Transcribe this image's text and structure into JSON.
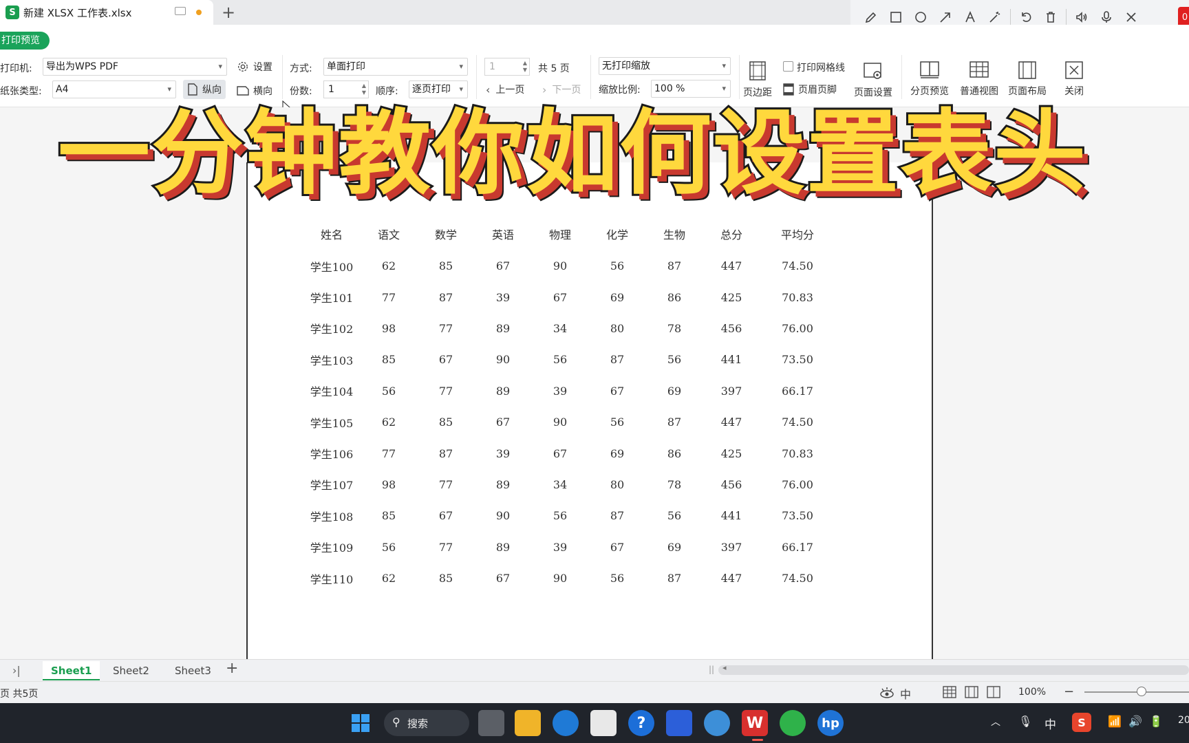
{
  "titlebar": {
    "app_logo": "S",
    "doc_title": "新建 XLSX 工作表.xlsx",
    "rec_badge": "0"
  },
  "toolbar": {
    "mode": "打印预览",
    "printer_label": "打印机:",
    "printer_value": "导出为WPS PDF",
    "settings_label": "设置",
    "paper_label": "纸张类型:",
    "paper_value": "A4",
    "portrait_label": "纵向",
    "landscape_label": "横向",
    "method_label": "方式:",
    "method_value": "单面打印",
    "copies_label": "份数:",
    "copies_value": "1",
    "order_label": "顺序:",
    "order_value": "逐页打印",
    "page_value": "1",
    "total_pages": "共 5 页",
    "prev_page": "上一页",
    "next_page": "下一页",
    "scale_mode_value": "无打印缩放",
    "scale_label": "缩放比例:",
    "scale_value": "100 %",
    "margins_label": "页边距",
    "gridlines_label": "打印网格线",
    "header_footer_label": "页眉页脚",
    "page_setup_label": "页面设置",
    "page_break_preview_label": "分页预览",
    "normal_view_label": "普通视图",
    "page_layout_label": "页面布局",
    "close_label": "关闭"
  },
  "overlay_title": "一分钟教你如何设置表头",
  "table": {
    "headers": [
      "姓名",
      "语文",
      "数学",
      "英语",
      "物理",
      "化学",
      "生物",
      "总分",
      "平均分"
    ],
    "rows": [
      [
        "学生100",
        "62",
        "85",
        "67",
        "90",
        "56",
        "87",
        "447",
        "74.50"
      ],
      [
        "学生101",
        "77",
        "87",
        "39",
        "67",
        "69",
        "86",
        "425",
        "70.83"
      ],
      [
        "学生102",
        "98",
        "77",
        "89",
        "34",
        "80",
        "78",
        "456",
        "76.00"
      ],
      [
        "学生103",
        "85",
        "67",
        "90",
        "56",
        "87",
        "56",
        "441",
        "73.50"
      ],
      [
        "学生104",
        "56",
        "77",
        "89",
        "39",
        "67",
        "69",
        "397",
        "66.17"
      ],
      [
        "学生105",
        "62",
        "85",
        "67",
        "90",
        "56",
        "87",
        "447",
        "74.50"
      ],
      [
        "学生106",
        "77",
        "87",
        "39",
        "67",
        "69",
        "86",
        "425",
        "70.83"
      ],
      [
        "学生107",
        "98",
        "77",
        "89",
        "34",
        "80",
        "78",
        "456",
        "76.00"
      ],
      [
        "学生108",
        "85",
        "67",
        "90",
        "56",
        "87",
        "56",
        "441",
        "73.50"
      ],
      [
        "学生109",
        "56",
        "77",
        "89",
        "39",
        "67",
        "69",
        "397",
        "66.17"
      ],
      [
        "学生110",
        "62",
        "85",
        "67",
        "90",
        "56",
        "87",
        "447",
        "74.50"
      ]
    ]
  },
  "sheets": [
    "Sheet1",
    "Sheet2",
    "Sheet3"
  ],
  "status": {
    "page_info": "页 共5页",
    "zoom": "100%",
    "input_mode": "中"
  },
  "taskbar": {
    "search_label": "搜索",
    "ime": "中",
    "clock_partial": "20"
  },
  "colors": {
    "accent_green": "#1a9e4f",
    "headline_fill": "#ffd83d",
    "headline_shadow": "#c8392f"
  }
}
